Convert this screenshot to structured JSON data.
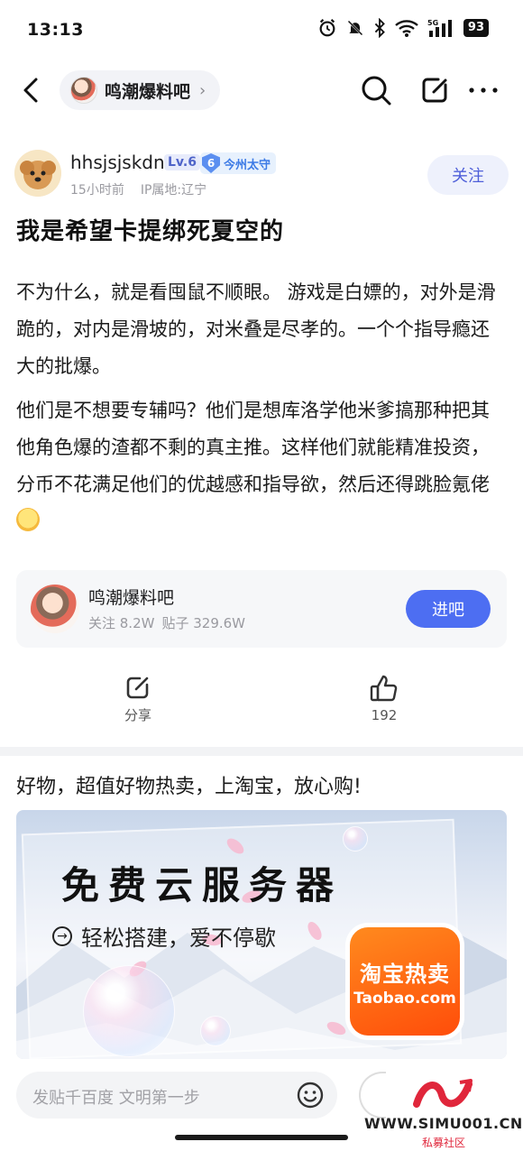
{
  "status_bar": {
    "time": "13:13",
    "battery": "93"
  },
  "nav": {
    "forum_name": "鸣潮爆料吧",
    "chevron": "›"
  },
  "author": {
    "name": "hhsjsjskdn",
    "level": "Lv.6",
    "title_badge_num": "6",
    "title_badge": "今州太守",
    "time_ago": "15小时前",
    "ip": "IP属地:辽宁",
    "follow_label": "关注"
  },
  "post": {
    "title": "我是希望卡提绑死夏空的",
    "paragraphs": [
      "不为什么，就是看囤鼠不顺眼。 游戏是白嫖的，对外是滑跪的，对内是滑坡的，对米叠是尽孝的。一个个指导瘾还大的批爆。",
      "他们是不想要专辅吗？他们是想库洛学他米爹搞那种把其他角色爆的渣都不剩的真主推。这样他们就能精准投资，分币不花满足他们的优越感和指导欲，然后还得跳脸氪佬"
    ]
  },
  "forum_card": {
    "name": "鸣潮爆料吧",
    "followers": "关注 8.2W",
    "posts": "贴子 329.6W",
    "enter_label": "进吧"
  },
  "actions": {
    "share_label": "分享",
    "like_count": "192"
  },
  "ad": {
    "title": "好物，超值好物热卖，上淘宝，放心购!",
    "headline": "免费云服务器",
    "sub": "轻松搭建，爱不停歇",
    "logo_cn": "淘宝热卖",
    "logo_en": "Taobao.com"
  },
  "bottom": {
    "comment_placeholder": "发贴千百度 文明第一步"
  },
  "watermark": {
    "url": "WWW.SIMU001.CN",
    "sub": "私募社区"
  },
  "colors": {
    "accent": "#4d6ef2",
    "follow_text": "#4e5fd9",
    "taobao_orange": "#ff5a0f"
  }
}
